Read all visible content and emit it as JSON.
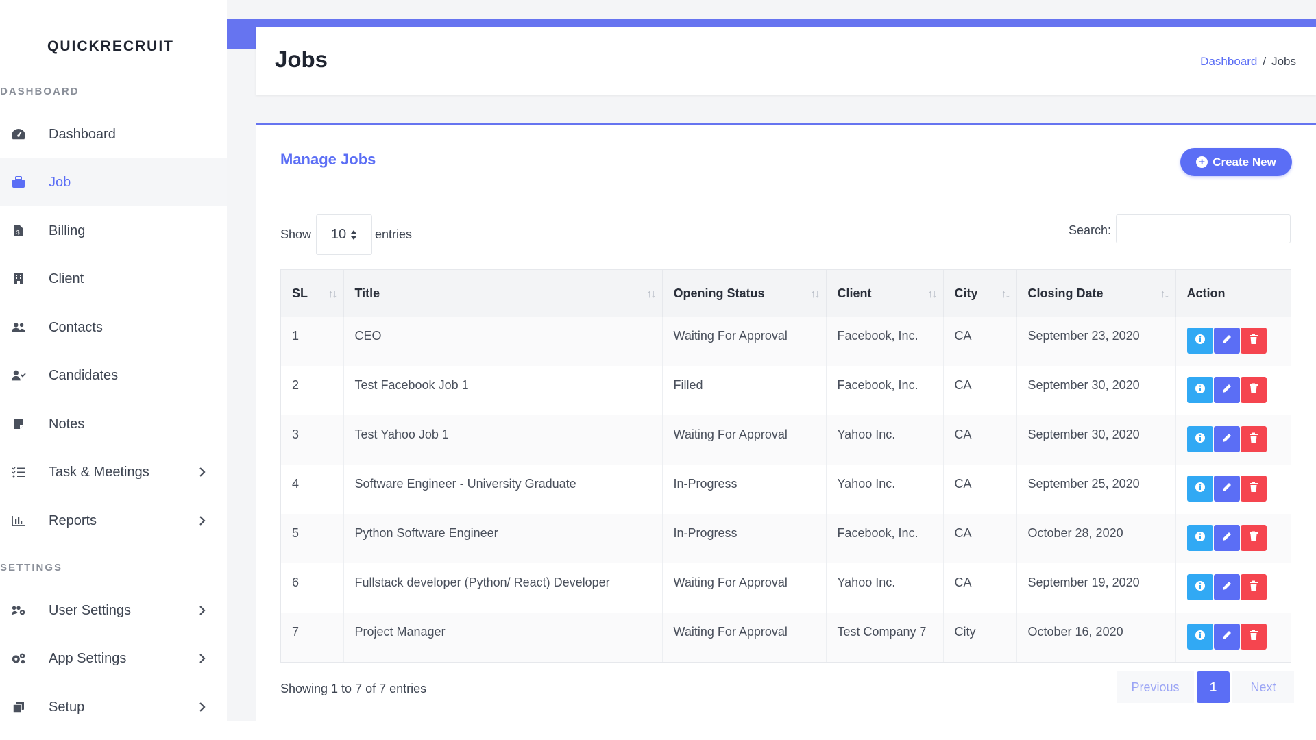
{
  "brand": "QUICKRECRUIT",
  "colors": {
    "accent": "#5b6ef5",
    "info": "#31a9f4",
    "danger": "#f5454f"
  },
  "sidebar": {
    "sections": [
      "DASHBOARD",
      "SETTINGS"
    ],
    "items": [
      {
        "label": "Dashboard",
        "icon": "speedometer-icon",
        "active": false,
        "has_submenu": false
      },
      {
        "label": "Job",
        "icon": "briefcase-icon",
        "active": true,
        "has_submenu": false
      },
      {
        "label": "Billing",
        "icon": "invoice-icon",
        "active": false,
        "has_submenu": false
      },
      {
        "label": "Client",
        "icon": "building-icon",
        "active": false,
        "has_submenu": false
      },
      {
        "label": "Contacts",
        "icon": "users-icon",
        "active": false,
        "has_submenu": false
      },
      {
        "label": "Candidates",
        "icon": "user-check-icon",
        "active": false,
        "has_submenu": false
      },
      {
        "label": "Notes",
        "icon": "note-icon",
        "active": false,
        "has_submenu": false
      },
      {
        "label": "Task & Meetings",
        "icon": "tasks-icon",
        "active": false,
        "has_submenu": true
      },
      {
        "label": "Reports",
        "icon": "bar-chart-icon",
        "active": false,
        "has_submenu": true
      },
      {
        "label": "User Settings",
        "icon": "users-cog-icon",
        "active": false,
        "has_submenu": true
      },
      {
        "label": "App Settings",
        "icon": "cogs-icon",
        "active": false,
        "has_submenu": true
      },
      {
        "label": "Setup",
        "icon": "clone-icon",
        "active": false,
        "has_submenu": true
      }
    ]
  },
  "header": {
    "title": "Jobs",
    "breadcrumb": {
      "link": "Dashboard",
      "separator": "/",
      "current": "Jobs"
    }
  },
  "card": {
    "title": "Manage Jobs",
    "create_label": "Create New",
    "show_label": "Show",
    "entries_value": "10",
    "entries_label": "entries",
    "search_label": "Search:",
    "search_value": ""
  },
  "table": {
    "columns": [
      "SL",
      "Title",
      "Opening Status",
      "Client",
      "City",
      "Closing Date",
      "Action"
    ],
    "rows": [
      {
        "sl": "1",
        "title": "CEO",
        "status": "Waiting For Approval",
        "client": "Facebook, Inc.",
        "city": "CA",
        "closing": "September 23, 2020"
      },
      {
        "sl": "2",
        "title": "Test Facebook Job 1",
        "status": "Filled",
        "client": "Facebook, Inc.",
        "city": "CA",
        "closing": "September 30, 2020"
      },
      {
        "sl": "3",
        "title": "Test Yahoo Job 1",
        "status": "Waiting For Approval",
        "client": "Yahoo Inc.",
        "city": "CA",
        "closing": "September 30, 2020"
      },
      {
        "sl": "4",
        "title": "Software Engineer - University Graduate",
        "status": "In-Progress",
        "client": "Yahoo Inc.",
        "city": "CA",
        "closing": "September 25, 2020"
      },
      {
        "sl": "5",
        "title": "Python Software Engineer",
        "status": "In-Progress",
        "client": "Facebook, Inc.",
        "city": "CA",
        "closing": "October 28, 2020"
      },
      {
        "sl": "6",
        "title": "Fullstack developer (Python/ React) Developer",
        "status": "Waiting For Approval",
        "client": "Yahoo Inc.",
        "city": "CA",
        "closing": "September 19, 2020"
      },
      {
        "sl": "7",
        "title": "Project Manager",
        "status": "Waiting For Approval",
        "client": "Test Company 7",
        "city": "City",
        "closing": "October 16, 2020"
      }
    ]
  },
  "footer": {
    "info": "Showing 1 to 7 of 7 entries",
    "prev_label": "Previous",
    "page": "1",
    "next_label": "Next"
  }
}
